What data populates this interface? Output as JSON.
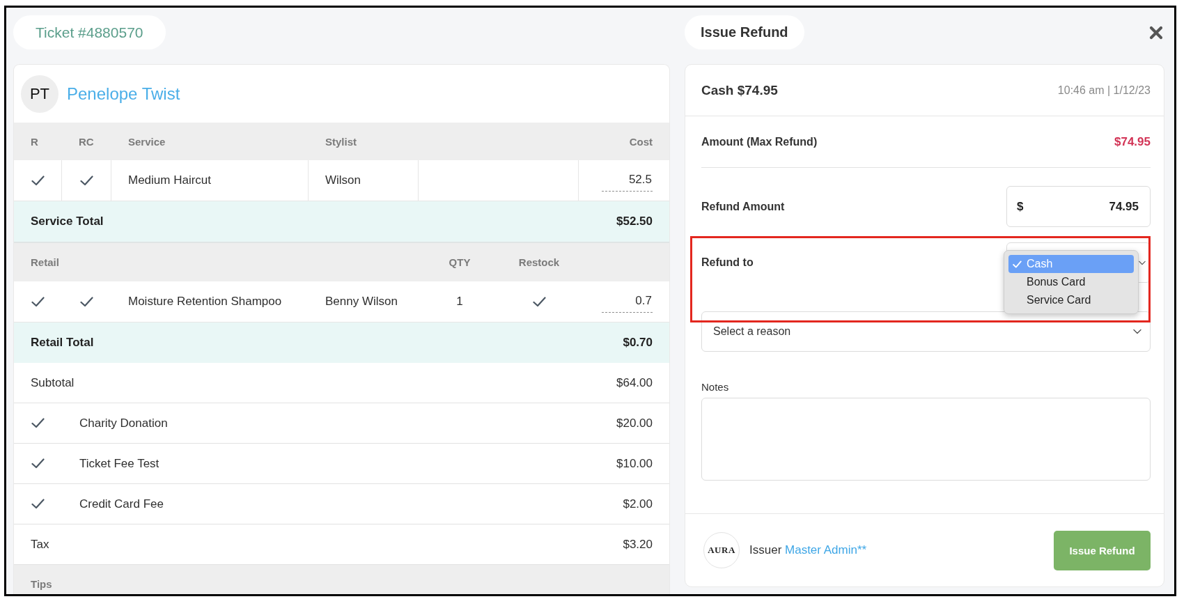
{
  "ticket": {
    "title": "Ticket #4880570"
  },
  "customer": {
    "initials": "PT",
    "name": "Penelope Twist"
  },
  "service_table": {
    "columns": [
      "R",
      "RC",
      "Service",
      "Stylist",
      "Cost"
    ],
    "rows": [
      {
        "r": true,
        "rc": true,
        "service": "Medium Haircut",
        "stylist": "Wilson",
        "cost": "52.5"
      }
    ],
    "total": {
      "label": "Service Total",
      "value": "$52.50"
    }
  },
  "retail_table": {
    "header": {
      "title": "Retail",
      "qty": "QTY",
      "restock": "Restock"
    },
    "rows": [
      {
        "r": true,
        "rc": true,
        "item": "Moisture Retention Shampoo",
        "stylist": "Benny Wilson",
        "qty": "1",
        "restock": true,
        "cost": "0.7"
      }
    ],
    "total": {
      "label": "Retail Total",
      "value": "$0.70"
    }
  },
  "summary": [
    {
      "kind": "line",
      "label": "Subtotal",
      "value": "$64.00"
    },
    {
      "kind": "fee",
      "checked": true,
      "label": "Charity Donation",
      "value": "$20.00"
    },
    {
      "kind": "fee",
      "checked": true,
      "label": "Ticket Fee Test",
      "value": "$10.00"
    },
    {
      "kind": "fee",
      "checked": true,
      "label": "Credit Card Fee",
      "value": "$2.00"
    },
    {
      "kind": "line",
      "label": "Tax",
      "value": "$3.20"
    }
  ],
  "tips": {
    "title": "Tips"
  },
  "refund": {
    "title": "Issue Refund",
    "payment": {
      "label": "Cash $74.95",
      "time": "10:46 am | 1/12/23"
    },
    "max_refund": {
      "label": "Amount (Max Refund)",
      "value": "$74.95"
    },
    "refund_amount": {
      "label": "Refund Amount",
      "currency": "$",
      "value": "74.95"
    },
    "refund_to": {
      "label": "Refund to",
      "highlighted": true,
      "expanded": true,
      "options": [
        {
          "label": "Cash",
          "selected": true
        },
        {
          "label": "Bonus Card",
          "selected": false
        },
        {
          "label": "Service Card",
          "selected": false
        }
      ]
    },
    "reason": {
      "placeholder": "Select a reason"
    },
    "notes": {
      "label": "Notes"
    },
    "issuer": {
      "logo": "AURA",
      "label": "Issuer",
      "name": "Master Admin**"
    },
    "submit": "Issue Refund"
  }
}
